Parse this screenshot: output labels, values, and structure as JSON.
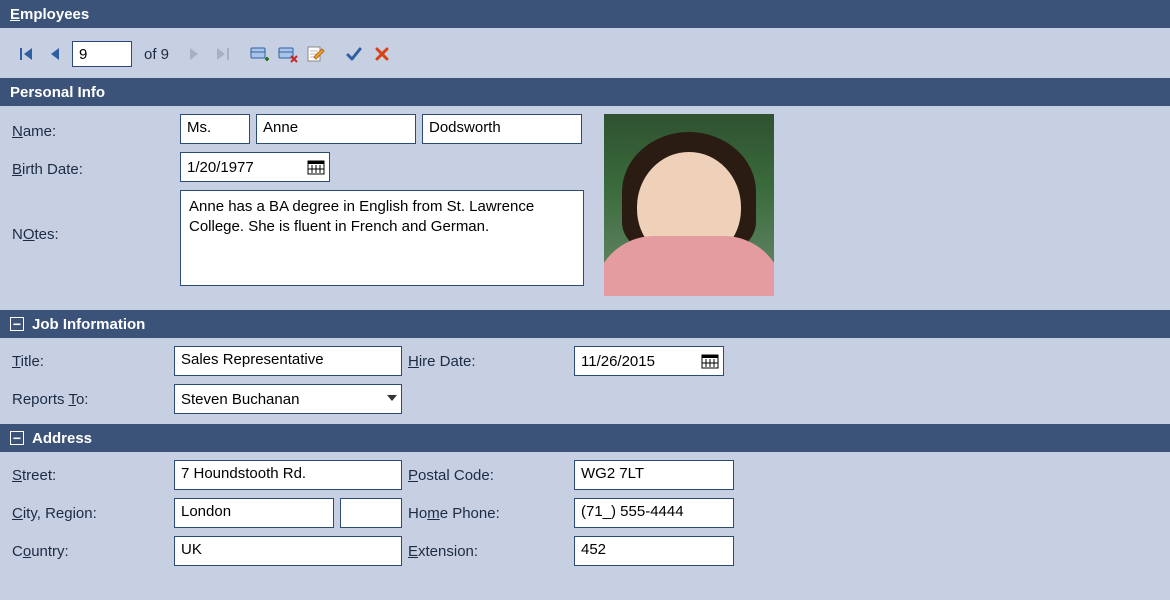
{
  "window": {
    "title_prefix_ul": "E",
    "title_rest": "mployees"
  },
  "navigator": {
    "record_number": "9",
    "of_label": "of 9"
  },
  "personal": {
    "section_title": "Personal Info",
    "name_label_ul": "N",
    "name_label_rest": "ame:",
    "title_of_courtesy": "Ms.",
    "first_name": "Anne",
    "last_name": "Dodsworth",
    "birthdate_label_ul": "B",
    "birthdate_label_rest": "irth Date:",
    "birth_date": "1/20/1977",
    "notes_label_ul": "O",
    "notes_label_pre": "N",
    "notes_label_rest": "tes:",
    "notes": "Anne has a BA degree in English from St. Lawrence College.  She is fluent in French and German."
  },
  "job": {
    "section_title": "Job Information",
    "title_label_ul": "T",
    "title_label_rest": "itle:",
    "title": "Sales Representative",
    "hiredate_label_ul": "H",
    "hiredate_label_rest": "ire Date:",
    "hire_date": "11/26/2015",
    "reportsto_label_pre": "Reports",
    "reportsto_label_ul": "T",
    "reportsto_label_rest": "o:",
    "reports_to": "Steven Buchanan"
  },
  "address": {
    "section_title": "Address",
    "street_label_ul": "S",
    "street_label_rest": "treet:",
    "street": "7 Houndstooth Rd.",
    "cityregion_label_ul": "C",
    "cityregion_label_rest": "ity, Region:",
    "city": "London",
    "region": "",
    "country_label_pre": "C",
    "country_label_ul": "o",
    "country_label_rest": "untry:",
    "country": "UK",
    "postal_label_ul": "P",
    "postal_label_rest": "ostal Code:",
    "postal_code": "WG2 7LT",
    "phone_label_pre": "Ho",
    "phone_label_ul": "m",
    "phone_label_rest": "e Phone:",
    "home_phone": "(71_) 555-4444",
    "ext_label_ul": "E",
    "ext_label_rest": "xtension:",
    "extension": "452"
  }
}
